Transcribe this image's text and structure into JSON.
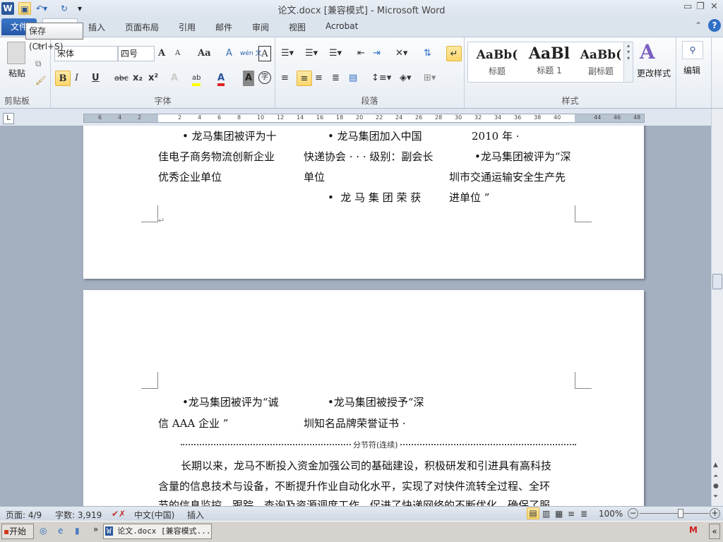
{
  "window": {
    "title": "论文.docx [兼容模式] - Microsoft Word",
    "app_icon": "W"
  },
  "quick_access": {
    "save": "save-icon",
    "undo": "undo-icon",
    "redo": "redo-icon",
    "customize": "▾"
  },
  "tooltip": "保存 (Ctrl+S)",
  "tabs": [
    {
      "label": "文件"
    },
    {
      "label": "开始"
    },
    {
      "label": "插入"
    },
    {
      "label": "页面布局"
    },
    {
      "label": "引用"
    },
    {
      "label": "邮件"
    },
    {
      "label": "审阅"
    },
    {
      "label": "视图"
    },
    {
      "label": "Acrobat"
    }
  ],
  "ribbon": {
    "clipboard": {
      "label": "剪贴板",
      "paste": "粘贴"
    },
    "font": {
      "label": "字体",
      "font_name": "宋体",
      "font_size": "四号",
      "bold": "B",
      "italic": "I",
      "underline": "U",
      "strike": "abc",
      "sub": "x₂",
      "sup": "x²",
      "grow": "A",
      "shrink": "A",
      "case": "Aa",
      "clear": "A",
      "phonetic": "wén 文",
      "border": "A",
      "text_effect": "A",
      "highlight": "ab",
      "font_color": "A",
      "shading": "A",
      "enclose": "字",
      "highlight_color": "#ffff00",
      "font_color_value": "#e02020"
    },
    "paragraph": {
      "label": "段落"
    },
    "styles": {
      "label": "样式",
      "items": [
        {
          "preview": "AaBb(",
          "name": "标题"
        },
        {
          "preview": "AaBl",
          "name": "标题 1"
        },
        {
          "preview": "AaBb(",
          "name": "副标题"
        }
      ],
      "change": "更改样式"
    },
    "editing": {
      "label": "编辑"
    }
  },
  "ruler": {
    "ticks": [
      "6",
      "4",
      "2",
      "2",
      "4",
      "6",
      "8",
      "10",
      "12",
      "14",
      "16",
      "18",
      "20",
      "22",
      "24",
      "26",
      "28",
      "30",
      "32",
      "34",
      "36",
      "38",
      "40",
      "44",
      "46",
      "48"
    ]
  },
  "page1": {
    "col1": [
      "• 龙马集团被评为十",
      "佳电子商务物流创新企业",
      "优秀企业单位"
    ],
    "col2": [
      "• 龙马集团加入中国",
      "快递协会 · · · 级别：副会长",
      "单位",
      "•  龙 马 集 团 荣 获"
    ],
    "col3": [
      "2010 年 ·",
      "•龙马集团被评为“深",
      "圳市交通运输安全生产先",
      "进单位 ”"
    ]
  },
  "page2": {
    "col1": [
      "•龙马集团被评为“诚",
      "信 AAA 企业 ”"
    ],
    "col2": [
      "•龙马集团被授予“深",
      "圳知名品牌荣誉证书 ·"
    ],
    "section_break": "分节符(连续)",
    "para": [
      "长期以来，龙马不断投入资金加强公司的基础建设，积极研发和引进具有高科技",
      "含量的信息技术与设备，不断提升作业自动化水平，实现了对快件流转全过程、全环",
      "节的信息监控、跟踪、查询及资源调度工作，促进了快递网络的不断优化，确保了服"
    ]
  },
  "status": {
    "page": "页面: 4/9",
    "words": "字数: 3,919",
    "language": "中文(中国)",
    "mode": "插入",
    "zoom": "100%",
    "zoom_level": 100
  },
  "taskbar": {
    "start": "开始",
    "task": "论文.docx [兼容模式..."
  }
}
